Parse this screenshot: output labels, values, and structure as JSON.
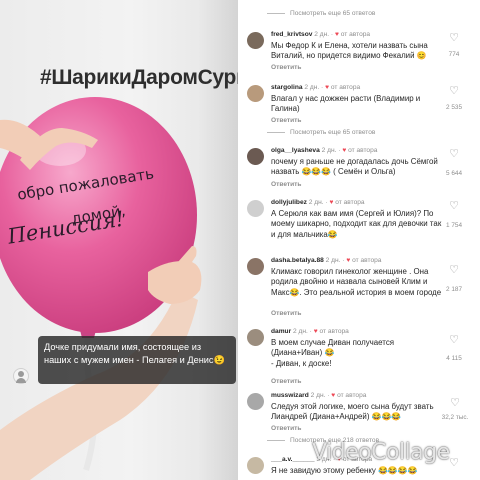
{
  "video": {
    "hashtag": "#ШарикиДаромСург",
    "balloon_line1": "обро пожаловать",
    "balloon_line2": "домой,",
    "balloon_line3": "Пенисcия!",
    "caption": "Дочке придумали имя, состоящее из наших с мужем имен - Пелагея и Денис😉",
    "colors": {
      "balloon": "#e8629e",
      "wall": "#ececec",
      "caption_bg": "#2d2d2d"
    }
  },
  "comments_panel": {
    "more_top": "Посмотреть еще 65 ответов",
    "comments": [
      {
        "user": "fred_krivtsov",
        "time": "2 дн.",
        "author_badge": "от автора",
        "text": "Мы Федор К и Елена, хотели назвать сына Виталий, но придется видимо Фекалий 😊",
        "reply": "Ответить",
        "likes": "774",
        "avatar_color": "#7a6a5c"
      },
      {
        "user": "stargolina",
        "time": "2 дн.",
        "author_badge": "от автора",
        "text": "Влагал у нас дожжен расти (Владимир и Галина)",
        "reply": "Ответить",
        "likes": "2 535",
        "avatar_color": "#b89a7c"
      },
      {
        "user": "olga__lyasheva",
        "time": "2 дн.",
        "author_badge": "от автора",
        "text": "почему я раньше не догадалась дочь Сёмгой назвать 😂😂😂 ( Семён и Ольга)",
        "reply": "Ответить",
        "likes": "5 644",
        "avatar_color": "#6b5a52"
      },
      {
        "user": "dollyjulibez",
        "time": "2 дн.",
        "author_badge": "от автора",
        "text": "А Серюля как вам имя (Сергей и Юлия)? По моему шикарно, подходит как для девочки так и для мальчика😂",
        "reply": "Ответить",
        "likes": "1 754",
        "avatar_color": "#cfcfcf"
      },
      {
        "user": "dasha.betalya.88",
        "time": "2 дн.",
        "author_badge": "от автора",
        "text": "Климакс говорил гинеколог женщине . Она родила двойню и назвала сыновей Клим и Макс😂. Это реальной история в моем городе",
        "reply": "Ответить",
        "likes": "2 187",
        "avatar_color": "#8a7466"
      },
      {
        "user": "damur",
        "time": "2 дн.",
        "author_badge": "от автора",
        "text": "В моем случае Диван получается (Диана+Иван) 😂\n- Диван, к доске!",
        "reply": "Ответить",
        "likes": "4 115",
        "avatar_color": "#9b8d7e"
      },
      {
        "user": "musswizard",
        "time": "2 дн.",
        "author_badge": "от автора",
        "text": "Следуя этой логике, моего сына будут звать Лиандрей (Диана+Андрей) 😂😂😂",
        "reply": "Ответить",
        "likes": "32,2 тыс.",
        "avatar_color": "#a8a8a8"
      }
    ],
    "more_bottom": "Посмотреть еще 218 ответов",
    "last_comment": {
      "user": "___a.v.______",
      "time": "3 дн.",
      "author_badge": "от автора",
      "text": "Я не завидую этому ребенку 😂😂😂😂",
      "avatar_color": "#c6b9a3"
    },
    "heart_icon": "heart-outline-icon"
  },
  "watermark": "VideoCollage"
}
